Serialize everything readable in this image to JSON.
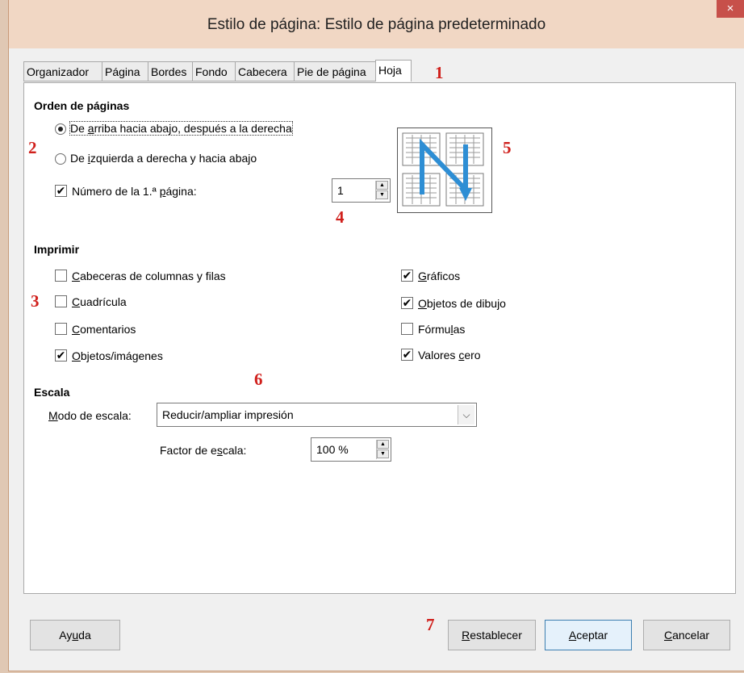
{
  "window": {
    "title": "Estilo de página: Estilo de página predeterminado",
    "close_glyph": "×"
  },
  "tabs": [
    {
      "label": "Organizador"
    },
    {
      "label": "Página"
    },
    {
      "label": "Bordes"
    },
    {
      "label": "Fondo"
    },
    {
      "label": "Cabecera"
    },
    {
      "label": "Pie de página"
    },
    {
      "label": "Hoja",
      "active": true
    }
  ],
  "markers": {
    "m1": "1",
    "m2": "2",
    "m3": "3",
    "m4": "4",
    "m5": "5",
    "m6": "6",
    "m7": "7"
  },
  "page_order": {
    "heading": "Orden de páginas",
    "top_bottom_pre": "De ",
    "top_bottom_key": "a",
    "top_bottom_post": "rriba hacia abajo, después a la derecha",
    "left_right_pre": "De ",
    "left_right_key": "i",
    "left_right_post": "zquierda a derecha y hacia abajo",
    "first_page_pre": "Número de la 1.ª ",
    "first_page_key": "p",
    "first_page_post": "ágina:",
    "first_page_value": "1",
    "top_bottom_selected": true,
    "first_page_checked": true
  },
  "print": {
    "heading": "Imprimir",
    "headers": {
      "key": "C",
      "rest": "abeceras de columnas y filas",
      "checked": false
    },
    "grid": {
      "key": "C",
      "rest": "uadrícula",
      "checked": false
    },
    "comments": {
      "key": "C",
      "rest": "omentarios",
      "checked": false
    },
    "objects": {
      "key": "O",
      "rest": "bjetos/imágenes",
      "checked": true
    },
    "charts": {
      "key": "G",
      "rest": "ráficos",
      "checked": true
    },
    "drawings": {
      "key": "O",
      "rest": "bjetos de dibujo",
      "checked": true
    },
    "formulas": {
      "pre": "Fórmu",
      "key": "l",
      "rest": "as",
      "checked": false
    },
    "zero": {
      "pre": "Valores ",
      "key": "c",
      "rest": "ero",
      "checked": true
    }
  },
  "scale": {
    "heading": "Escala",
    "mode_key": "M",
    "mode_rest": "odo de escala:",
    "mode_value": "Reducir/ampliar impresión",
    "factor_pre": "Factor de e",
    "factor_key": "s",
    "factor_rest": "cala:",
    "factor_value": "100 %"
  },
  "buttons": {
    "help_pre": "Ay",
    "help_key": "u",
    "help_rest": "da",
    "reset_key": "R",
    "reset_rest": "establecer",
    "ok_key": "A",
    "ok_rest": "ceptar",
    "cancel_key": "C",
    "cancel_rest": "ancelar"
  },
  "icons": {
    "close": "close-icon",
    "radio": "radio-button",
    "checkbox": "checkbox",
    "spin_up": "spin-up-icon",
    "spin_down": "spin-down-icon",
    "dropdown": "chevron-down-icon",
    "preview": "page-order-preview-icon"
  },
  "colors": {
    "titlebar": "#f1d7c4",
    "close_button": "#c7504a",
    "marker": "#d0201c",
    "preview_arrow": "#2e8ed4"
  }
}
